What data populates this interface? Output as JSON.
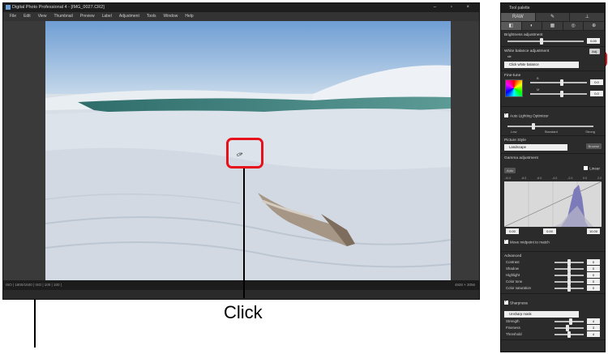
{
  "window": {
    "title": "Digital Photo Professional 4 - [IMG_0027.CR2]",
    "controls": "–  ▫  ×"
  },
  "menu": [
    "File",
    "Edit",
    "View",
    "Thumbnail",
    "Preview",
    "Label",
    "Adjustment",
    "Tools",
    "Window",
    "Help"
  ],
  "status": {
    "left": "ISO | 1800/1600 | ISO | 100 | 100 |",
    "right": "4928 × 3056"
  },
  "callout": {
    "click_label": "Click"
  },
  "palette": {
    "title": "Tool palette",
    "top_tabs": [
      "RAW",
      "✎",
      "⊥"
    ],
    "sub_tabs": [
      "◧",
      "◐",
      "▦",
      "◎",
      "⊕"
    ],
    "brightness": {
      "title": "Brightness adjustment",
      "value": "0.00",
      "position": 0.45
    },
    "white_balance": {
      "title": "White balance adjustment",
      "adj_button": "Adj.",
      "mode": "Click white balance"
    },
    "fine_tune": {
      "title": "Fine-tune",
      "b_label": "B",
      "b_value": "0.0",
      "m_label": "M",
      "m_value": "0.0",
      "b_position": 0.55,
      "m_position": 0.55
    },
    "alo": {
      "label": "Auto Lighting Optimizer",
      "levels": [
        "Low",
        "Standard",
        "Strong"
      ],
      "position": 0.3
    },
    "picture_style": {
      "title": "Picture Style",
      "value": "Landscape",
      "browse": "Browse"
    },
    "gamma": {
      "title": "Gamma adjustment",
      "auto_button": "Auto",
      "linear_label": "Linear",
      "ticks": [
        "-10.0",
        "-8.0",
        "-6.0",
        "-4.0",
        "-2.0",
        "0.0",
        "2.0"
      ],
      "in_min": "0.00",
      "mid": "0.00",
      "in_max": "10.00"
    },
    "move_midpoint": "Move midpoint to match",
    "advanced": {
      "title": "Advanced",
      "rows": [
        {
          "label": "Contrast",
          "value": "0",
          "position": 0.5
        },
        {
          "label": "Shadow",
          "value": "0",
          "position": 0.5
        },
        {
          "label": "Highlight",
          "value": "0",
          "position": 0.5
        },
        {
          "label": "Color tone",
          "value": "0",
          "position": 0.5
        },
        {
          "label": "Color saturation",
          "value": "0",
          "position": 0.5
        }
      ]
    },
    "sharpness": {
      "label": "Sharpness",
      "mode": "Unsharp mask",
      "rows": [
        {
          "label": "Strength",
          "value": "4",
          "position": 0.55
        },
        {
          "label": "Fineness",
          "value": "3",
          "position": 0.45
        },
        {
          "label": "Threshold",
          "value": "4",
          "position": 0.5
        }
      ]
    }
  }
}
